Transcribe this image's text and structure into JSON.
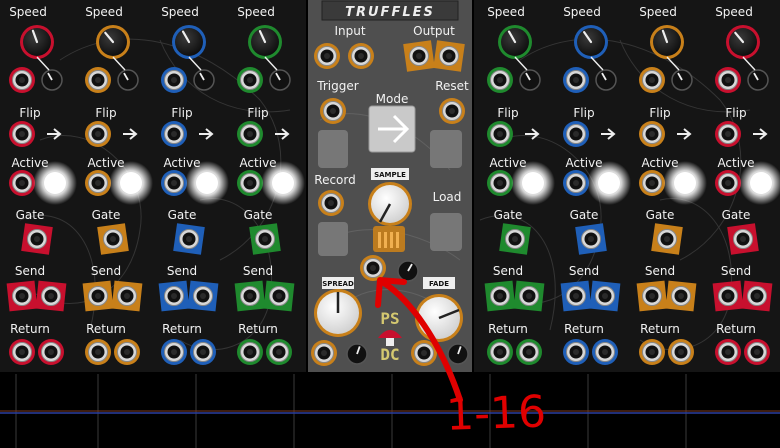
{
  "colors": {
    "panel": "#1a1a1a",
    "center_panel": "#555555",
    "red": "#c8102e",
    "orange": "#c8801a",
    "blue": "#1f5fb8",
    "green": "#1f8a2e",
    "annotation": "#e00000"
  },
  "left_module": {
    "column_colors": [
      "red",
      "orange",
      "blue",
      "green"
    ],
    "labels": {
      "speed": "Speed",
      "flip": "Flip",
      "active": "Active",
      "gate": "Gate",
      "send": "Send",
      "return": "Return"
    }
  },
  "center_module": {
    "title": "TRUFFLES",
    "input": "Input",
    "output": "Output",
    "trigger": "Trigger",
    "mode": "Mode",
    "reset": "Reset",
    "record": "Record",
    "sample_tag": "SAMPLE",
    "load": "Load",
    "spread_tag": "SPREAD",
    "fade_tag": "FADE",
    "logo_top": "PS",
    "logo_bottom": "DC"
  },
  "right_module": {
    "column_colors": [
      "green",
      "blue",
      "orange",
      "red"
    ],
    "labels": {
      "speed": "Speed",
      "flip": "Flip",
      "active": "Active",
      "gate": "Gate",
      "send": "Send",
      "return": "Return"
    }
  },
  "annotation": {
    "text": "1-16"
  },
  "icons": {
    "arrow": "right-arrow-icon",
    "mushroom": "mushroom-logo-icon"
  }
}
